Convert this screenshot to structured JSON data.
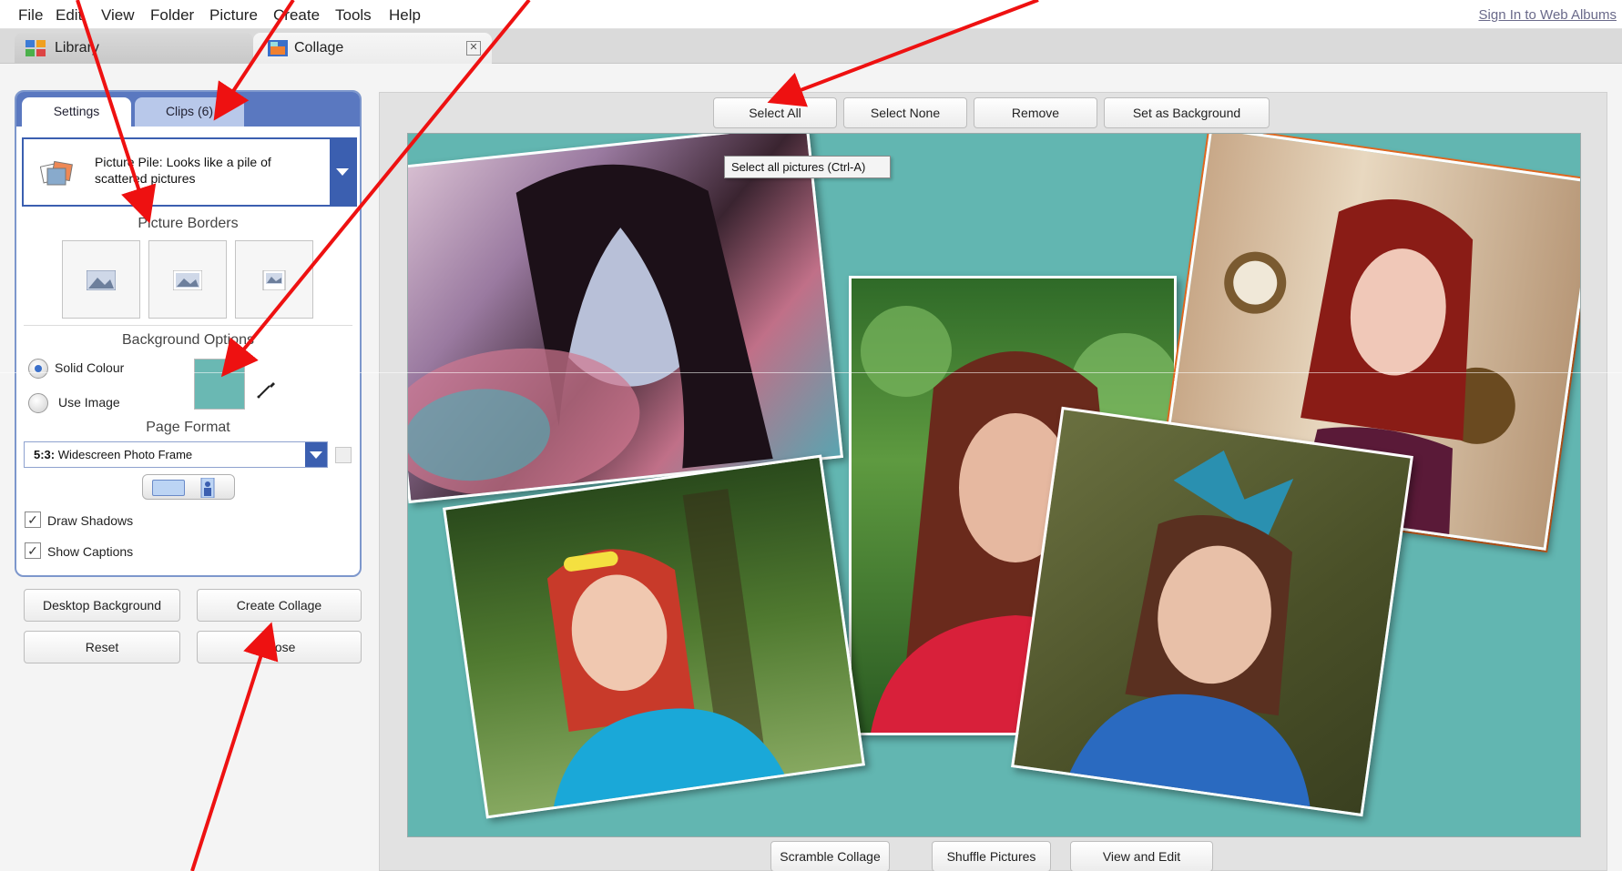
{
  "menu": {
    "items": [
      "File",
      "Edit",
      "View",
      "Folder",
      "Picture",
      "Create",
      "Tools",
      "Help"
    ],
    "sign_in": "Sign In to Web Albums"
  },
  "tabs": {
    "library": "Library",
    "collage": "Collage",
    "close_icon": "close-icon"
  },
  "panel": {
    "tab_settings": "Settings",
    "tab_clips": "Clips (6)",
    "style_text": "Picture Pile:  Looks like a pile of scattered pictures",
    "picture_borders_title": "Picture Borders",
    "background_options_title": "Background Options",
    "solid_colour": "Solid Colour",
    "use_image": "Use Image",
    "solid_selected": true,
    "swatch_color": "#6ab8b3",
    "page_format_title": "Page Format",
    "page_format_ratio": "5:3:",
    "page_format_value": " Widescreen Photo Frame",
    "draw_shadows": "Draw Shadows",
    "show_captions": "Show Captions",
    "draw_shadows_checked": true,
    "show_captions_checked": true
  },
  "buttons": {
    "desktop_background": "Desktop Background",
    "create_collage": "Create Collage",
    "reset": "Reset",
    "close": "Close"
  },
  "toolbar": {
    "select_all": "Select All",
    "select_none": "Select None",
    "remove": "Remove",
    "set_as_background": "Set as Background"
  },
  "tooltip": "Select all pictures (Ctrl-A)",
  "bottom_toolbar": {
    "scramble": "Scramble Collage",
    "shuffle": "Shuffle Pictures",
    "view_edit": "View and Edit"
  },
  "colors": {
    "collage_background": "#62b6b1",
    "panel_accent": "#5a78c0",
    "annotation_arrow": "#ee1111"
  }
}
